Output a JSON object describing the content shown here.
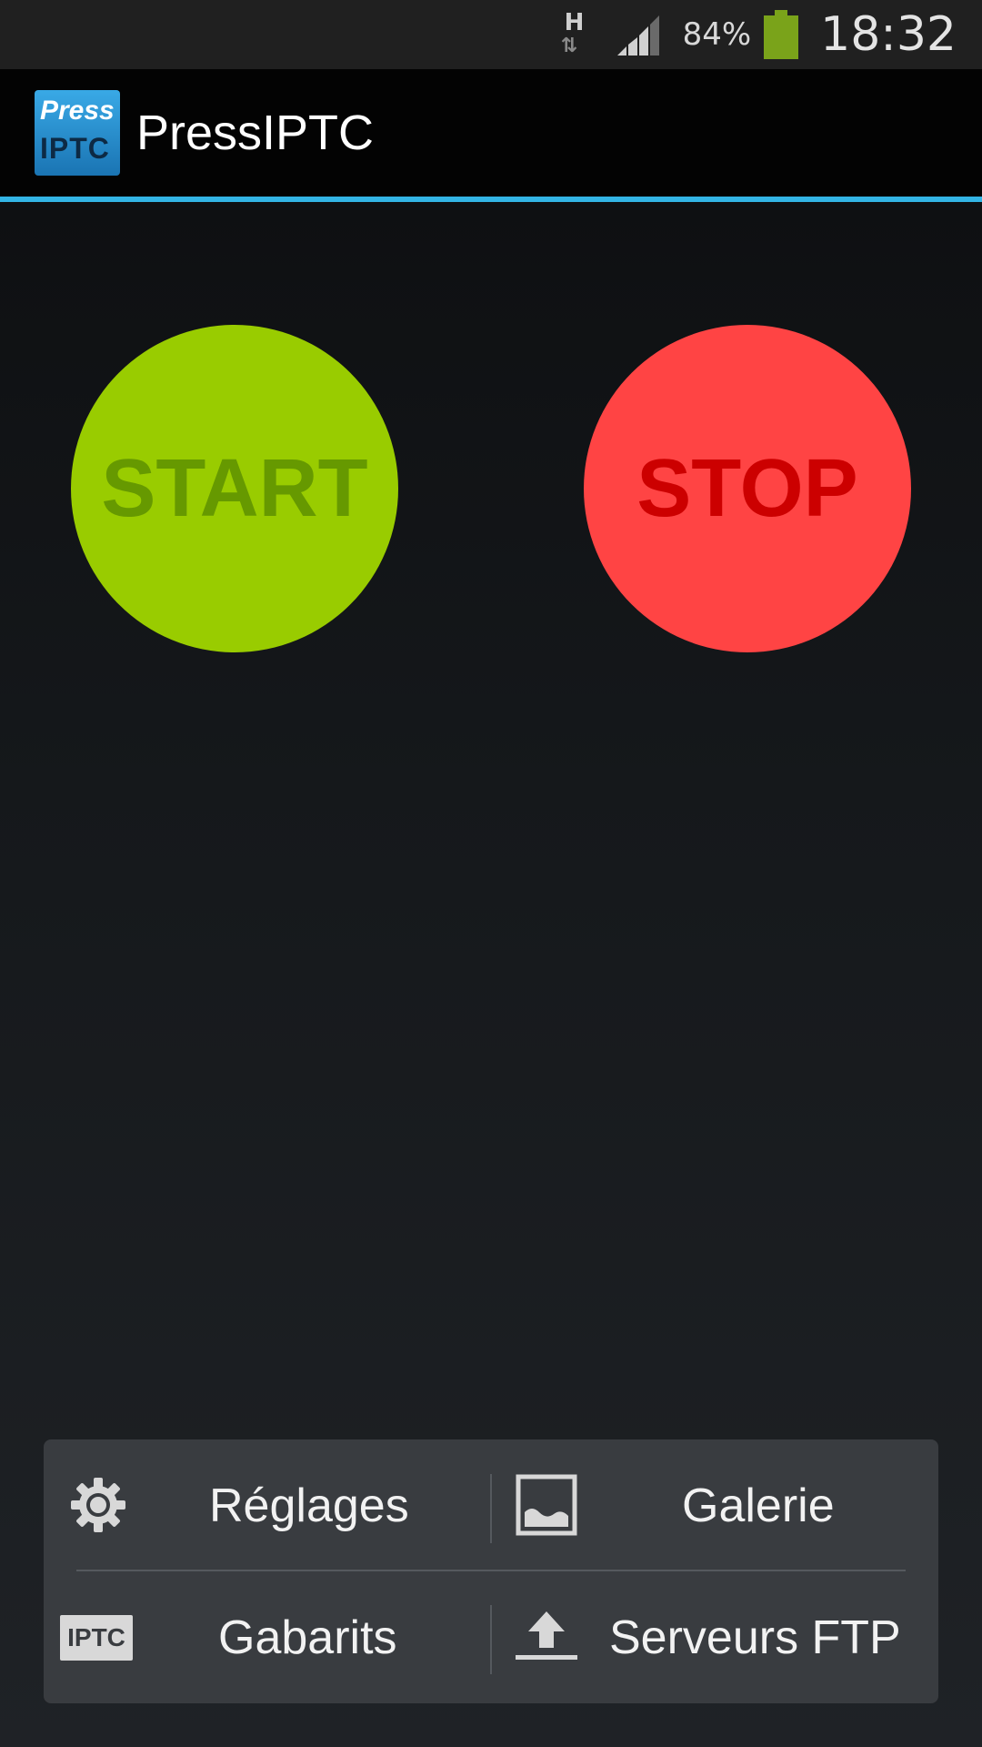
{
  "status_bar": {
    "network_type": "H",
    "battery_percent": "84%",
    "time": "18:32",
    "icons": [
      "network-type-icon",
      "signal-icon",
      "battery-icon"
    ]
  },
  "action_bar": {
    "logo_top": "Press",
    "logo_bottom": "IPTC",
    "title": "PressIPTC"
  },
  "controls": {
    "start_label": "START",
    "stop_label": "STOP",
    "start_color": "#99cc00",
    "stop_color": "#ff4444"
  },
  "menu": {
    "items": [
      {
        "label": "Réglages",
        "icon": "gear-icon"
      },
      {
        "label": "Galerie",
        "icon": "image-icon"
      },
      {
        "label": "Gabarits",
        "icon": "iptc-badge-icon",
        "icon_text": "IPTC"
      },
      {
        "label": "Serveurs FTP",
        "icon": "upload-icon"
      }
    ]
  },
  "colors": {
    "accent": "#33b5e5",
    "menu_background": "#393c40"
  }
}
